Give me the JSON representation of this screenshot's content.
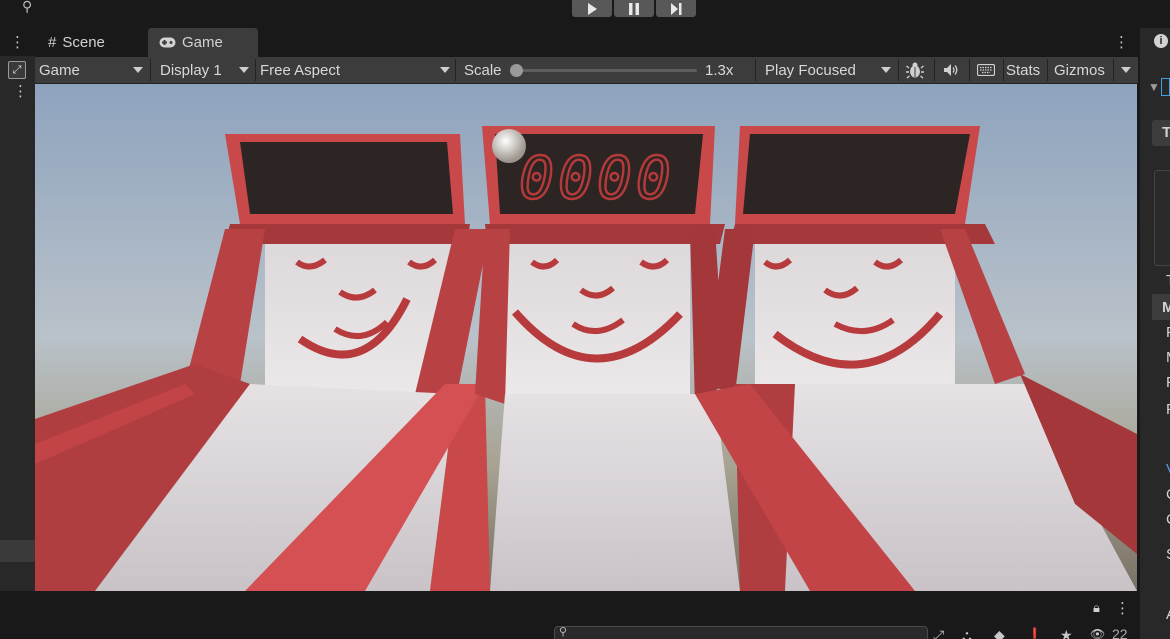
{
  "window": {
    "play_icon": "play-icon",
    "pause_icon": "pause-icon",
    "step_icon": "step-icon"
  },
  "tabs": [
    {
      "label": "Scene",
      "icon": "grid-icon"
    },
    {
      "label": "Game",
      "icon": "gamepad-icon"
    }
  ],
  "toolbar": {
    "view_select": "Game",
    "display_select": "Display 1",
    "aspect_select": "Free Aspect",
    "scale_label": "Scale",
    "scale_value": "1.3x",
    "scale_fraction": 0.0,
    "play_mode_select": "Play Focused",
    "stats_label": "Stats",
    "gizmos_label": "Gizmos"
  },
  "game": {
    "score_display": "0000"
  },
  "inspector": {
    "letters": [
      "T",
      "T",
      "M",
      "F",
      "M",
      "F",
      "F",
      "V",
      "C",
      "C",
      "S",
      "A"
    ]
  },
  "bottom": {
    "search_placeholder": "",
    "hidden_count": "22"
  },
  "colors": {
    "accent_red": "#c9484a",
    "dark_red": "#8f2d2f",
    "panel": "#3c3c3c",
    "background": "#191919"
  }
}
